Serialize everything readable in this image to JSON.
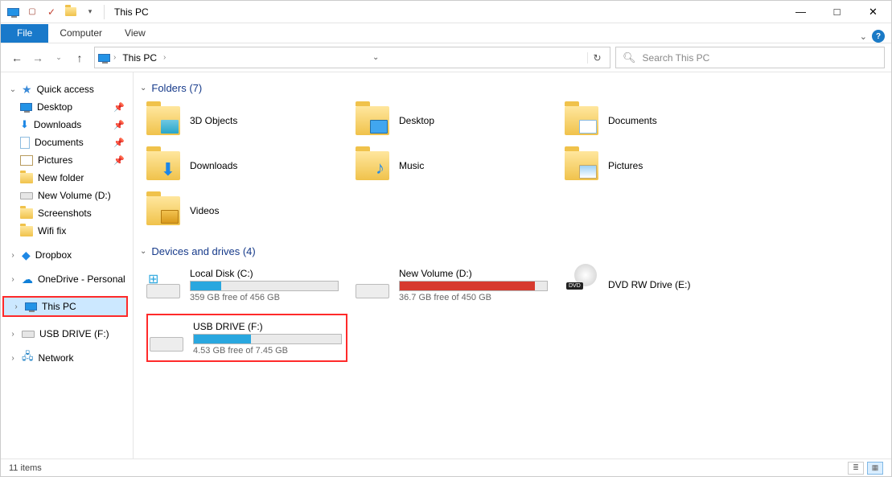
{
  "window": {
    "title": "This PC"
  },
  "tabs": {
    "file": "File",
    "computer": "Computer",
    "view": "View"
  },
  "breadcrumb": {
    "location": "This PC"
  },
  "search": {
    "placeholder": "Search This PC"
  },
  "sidebar": {
    "quick_access": "Quick access",
    "items": [
      {
        "label": "Desktop",
        "pinned": true
      },
      {
        "label": "Downloads",
        "pinned": true
      },
      {
        "label": "Documents",
        "pinned": true
      },
      {
        "label": "Pictures",
        "pinned": true
      },
      {
        "label": "New folder",
        "pinned": false
      },
      {
        "label": "New Volume (D:)",
        "pinned": false
      },
      {
        "label": "Screenshots",
        "pinned": false
      },
      {
        "label": "Wifi fix",
        "pinned": false
      }
    ],
    "dropbox": "Dropbox",
    "onedrive": "OneDrive - Personal",
    "this_pc": "This PC",
    "usb": "USB DRIVE (F:)",
    "network": "Network"
  },
  "sections": {
    "folders_hdr": "Folders (7)",
    "drives_hdr": "Devices and drives (4)"
  },
  "folders": [
    {
      "label": "3D Objects"
    },
    {
      "label": "Desktop"
    },
    {
      "label": "Documents"
    },
    {
      "label": "Downloads"
    },
    {
      "label": "Music"
    },
    {
      "label": "Pictures"
    },
    {
      "label": "Videos"
    }
  ],
  "drives": [
    {
      "name": "Local Disk (C:)",
      "free": "359 GB free of 456 GB",
      "fill": 21,
      "color": "blue",
      "type": "hdd-win"
    },
    {
      "name": "New Volume (D:)",
      "free": "36.7 GB free of 450 GB",
      "fill": 92,
      "color": "red",
      "type": "hdd"
    },
    {
      "name": "DVD RW Drive (E:)",
      "free": "",
      "fill": 0,
      "color": "",
      "type": "dvd"
    },
    {
      "name": "USB DRIVE (F:)",
      "free": "4.53 GB free of 7.45 GB",
      "fill": 39,
      "color": "blue",
      "type": "usb",
      "highlight": true
    }
  ],
  "status": {
    "text": "11 items"
  }
}
